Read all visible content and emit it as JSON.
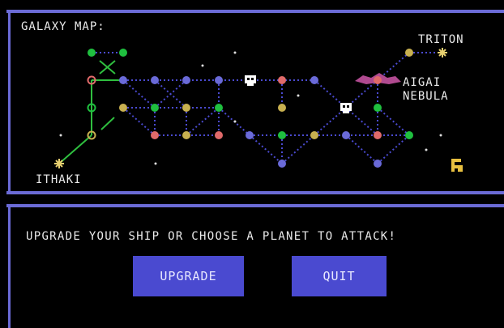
{
  "map": {
    "title": "GALAXY MAP:",
    "labels": {
      "triton": "TRITON",
      "aigai_line1": "AIGAI",
      "aigai_line2": "NEBULA",
      "ithaki": "ITHAKI"
    }
  },
  "prompt": "UPGRADE YOUR SHIP OR CHOOSE A PLANET TO ATTACK!",
  "buttons": {
    "upgrade": "UPGRADE",
    "quit": "QUIT"
  },
  "colors": {
    "frame": "#6b6bd6",
    "blue_planet": "#6a6ad8",
    "green_planet": "#1fbf3f",
    "red_planet": "#e06a6a",
    "yellow_planet": "#c8b050",
    "link": "#4a4ad0",
    "green_link": "#2fbf3f"
  }
}
